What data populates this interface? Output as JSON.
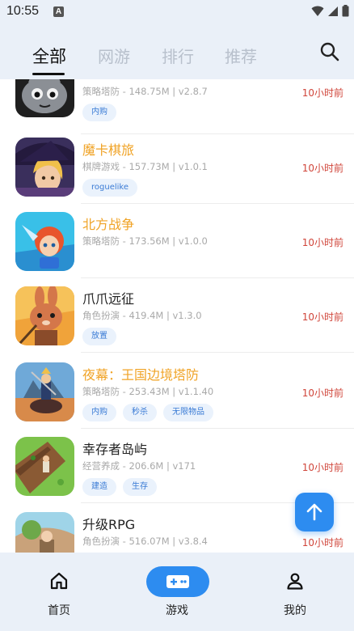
{
  "status_bar": {
    "time": "10:55",
    "notif_letter": "A"
  },
  "header": {
    "tabs": [
      {
        "label": "全部",
        "active": true
      },
      {
        "label": "网游",
        "active": false
      },
      {
        "label": "排行",
        "active": false
      },
      {
        "label": "推荐",
        "active": false
      }
    ]
  },
  "games": [
    {
      "name": "",
      "meta": "策略塔防 - 148.75M | v2.8.7",
      "time": "10小时前",
      "tags": [
        "内购"
      ],
      "hot": false
    },
    {
      "name": "魔卡棋旅",
      "meta": "棋牌游戏 - 157.73M | v1.0.1",
      "time": "10小时前",
      "tags": [
        "roguelike"
      ],
      "hot": true
    },
    {
      "name": "北方战争",
      "meta": "策略塔防 - 173.56M | v1.0.0",
      "time": "10小时前",
      "tags": [],
      "hot": true
    },
    {
      "name": "爪爪远征",
      "meta": "角色扮演 - 419.4M | v1.3.0",
      "time": "10小时前",
      "tags": [
        "放置"
      ],
      "hot": false
    },
    {
      "name": "夜幕：王国边境塔防",
      "meta": "策略塔防 - 253.43M | v1.1.40",
      "time": "10小时前",
      "tags": [
        "内购",
        "秒杀",
        "无限物品"
      ],
      "hot": true
    },
    {
      "name": "幸存者岛屿",
      "meta": "经营养成 - 206.6M | v171",
      "time": "10小时前",
      "tags": [
        "建造",
        "生存"
      ],
      "hot": false
    },
    {
      "name": "升级RPG",
      "meta": "角色扮演 - 516.07M | v3.8.4",
      "time": "10小时前",
      "tags": [],
      "hot": false
    }
  ],
  "bottom_nav": [
    {
      "label": "首页",
      "icon": "home-icon"
    },
    {
      "label": "游戏",
      "icon": "gamepad-icon",
      "active": true
    },
    {
      "label": "我的",
      "icon": "user-icon"
    }
  ],
  "colors": {
    "accent": "#2d8cf0",
    "hot_name": "#f0a326",
    "time_red": "#d0453a",
    "bar_bg": "#eaf0f8"
  }
}
